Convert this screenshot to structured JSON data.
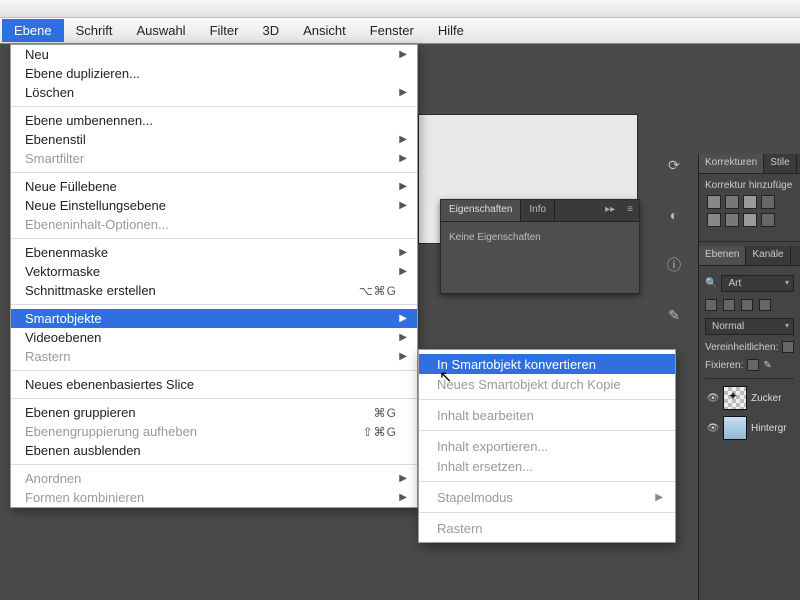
{
  "menubar": {
    "items": [
      "Ebene",
      "Schrift",
      "Auswahl",
      "Filter",
      "3D",
      "Ansicht",
      "Fenster",
      "Hilfe"
    ],
    "active_index": 0
  },
  "dropdown": [
    {
      "label": "Neu",
      "arrow": true
    },
    {
      "label": "Ebene duplizieren..."
    },
    {
      "label": "Löschen",
      "arrow": true
    },
    {
      "sep": true
    },
    {
      "label": "Ebene umbenennen..."
    },
    {
      "label": "Ebenenstil",
      "arrow": true
    },
    {
      "label": "Smartfilter",
      "arrow": true,
      "disabled": true
    },
    {
      "sep": true
    },
    {
      "label": "Neue Füllebene",
      "arrow": true
    },
    {
      "label": "Neue Einstellungsebene",
      "arrow": true
    },
    {
      "label": "Ebeneninhalt-Optionen...",
      "disabled": true
    },
    {
      "sep": true
    },
    {
      "label": "Ebenenmaske",
      "arrow": true
    },
    {
      "label": "Vektormaske",
      "arrow": true
    },
    {
      "label": "Schnittmaske erstellen",
      "shortcut": "⌥⌘G"
    },
    {
      "sep": true
    },
    {
      "label": "Smartobjekte",
      "arrow": true,
      "highlight": true
    },
    {
      "label": "Videoebenen",
      "arrow": true
    },
    {
      "label": "Rastern",
      "arrow": true,
      "disabled": true
    },
    {
      "sep": true
    },
    {
      "label": "Neues ebenenbasiertes Slice"
    },
    {
      "sep": true
    },
    {
      "label": "Ebenen gruppieren",
      "shortcut": "⌘G"
    },
    {
      "label": "Ebenengruppierung aufheben",
      "shortcut": "⇧⌘G",
      "disabled": true
    },
    {
      "label": "Ebenen ausblenden"
    },
    {
      "sep": true
    },
    {
      "label": "Anordnen",
      "arrow": true,
      "disabled": true
    },
    {
      "label": "Formen kombinieren",
      "arrow": true,
      "disabled": true
    }
  ],
  "submenu": [
    {
      "label": "In Smartobjekt konvertieren",
      "highlight": true
    },
    {
      "label": "Neues Smartobjekt durch Kopie",
      "disabled": true
    },
    {
      "sep": true
    },
    {
      "label": "Inhalt bearbeiten",
      "disabled": true
    },
    {
      "sep": true
    },
    {
      "label": "Inhalt exportieren...",
      "disabled": true
    },
    {
      "label": "Inhalt ersetzen...",
      "disabled": true
    },
    {
      "sep": true
    },
    {
      "label": "Stapelmodus",
      "arrow": true,
      "disabled": true
    },
    {
      "sep": true
    },
    {
      "label": "Rastern",
      "disabled": true
    }
  ],
  "eig": {
    "tabs": [
      "Eigenschaften",
      "Info"
    ],
    "body": "Keine Eigenschaften"
  },
  "rpanel": {
    "top_tabs": [
      "Korrekturen",
      "Stile"
    ],
    "top_label": "Korrektur hinzufüge",
    "layer_tabs": [
      "Ebenen",
      "Kanäle"
    ],
    "filter": "Art",
    "blend": "Normal",
    "unify": "Vereinheitlichen:",
    "lock": "Fixieren:",
    "layers": [
      {
        "name": "Zucker",
        "thumb": "checker"
      },
      {
        "name": "Hintergr",
        "thumb": "img"
      }
    ]
  }
}
